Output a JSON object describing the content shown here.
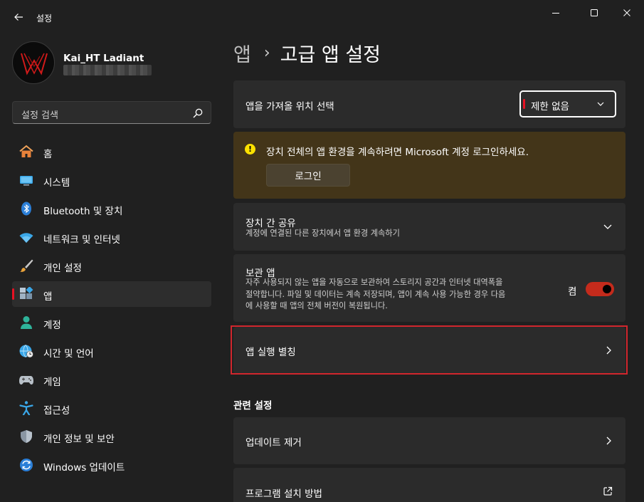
{
  "window": {
    "title": "설정",
    "controls": [
      "minimize",
      "maximize",
      "close"
    ]
  },
  "profile": {
    "name": "Kai_HT Ladiant"
  },
  "search": {
    "placeholder": "설정 검색"
  },
  "sidebar": {
    "items": [
      {
        "label": "홈",
        "icon": "home-icon"
      },
      {
        "label": "시스템",
        "icon": "monitor-icon"
      },
      {
        "label": "Bluetooth 및 장치",
        "icon": "bluetooth-icon"
      },
      {
        "label": "네트워크 및 인터넷",
        "icon": "wifi-icon"
      },
      {
        "label": "개인 설정",
        "icon": "brush-icon"
      },
      {
        "label": "앱",
        "icon": "apps-icon",
        "active": true
      },
      {
        "label": "계정",
        "icon": "person-icon"
      },
      {
        "label": "시간 및 언어",
        "icon": "globe-clock-icon"
      },
      {
        "label": "게임",
        "icon": "gamepad-icon"
      },
      {
        "label": "접근성",
        "icon": "accessibility-icon"
      },
      {
        "label": "개인 정보 및 보안",
        "icon": "shield-icon"
      },
      {
        "label": "Windows 업데이트",
        "icon": "update-icon"
      }
    ]
  },
  "breadcrumb": {
    "parent": "앱",
    "separator": "›",
    "current": "고급 앱 설정"
  },
  "settings": {
    "install_source": {
      "title": "앱을 가져올 위치 선택",
      "dropdown_value": "제한 없음"
    },
    "banner": {
      "message": "장치 전체의 앱 환경을 계속하려면 Microsoft 계정 로그인하세요.",
      "button": "로그인"
    },
    "share": {
      "title": "장치 간 공유",
      "subtitle": "계정에 연결된 다른 장치에서 앱 환경 계속하기"
    },
    "archive": {
      "title": "보관 앱",
      "subtitle_lines": [
        "자주 사용되지 않는 앱을 자동으로 보관하여 스토리지 공간과 인터넷 대역폭을",
        "절약합니다. 파일 및 데이터는 계속 저장되며, 앱이 계속 사용 가능한 경우 다음",
        "에 사용할 때 앱의 전체 버전이 복원됩니다."
      ],
      "toggle_label": "켬",
      "toggle_on": true
    },
    "aliases": {
      "title": "앱 실행 별칭"
    }
  },
  "related": {
    "title": "관련 설정",
    "items": [
      {
        "label": "업데이트 제거",
        "icon": "chevron-right-icon"
      },
      {
        "label": "프로그램 설치 방법",
        "icon": "external-link-icon"
      }
    ]
  },
  "colors": {
    "accent": "#e81123",
    "toggle_on": "#c42b1c",
    "banner_bg": "#433519",
    "highlight": "#d1262d"
  }
}
